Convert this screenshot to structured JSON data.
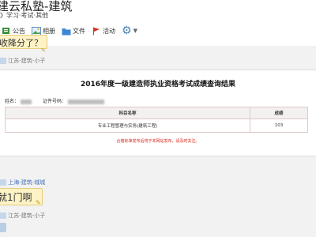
{
  "header": {
    "title": "建云私塾-建筑",
    "subtitle": "》学习·考试·其他"
  },
  "toolbar": {
    "items": [
      {
        "label": "公告"
      },
      {
        "label": "相册"
      },
      {
        "label": "文件"
      },
      {
        "label": "活动"
      }
    ]
  },
  "posts": [
    {
      "text": "收降分了？",
      "meta_location": "江苏-建筑-小子"
    },
    {
      "text": "就1门啊",
      "meta_location_top": "上海-建筑-城城",
      "meta_location": "江苏-建筑-小子"
    }
  ],
  "result": {
    "title": "2016年度一级建造师执业资格考试成绩查询结果",
    "name_label": "姓名：",
    "id_label": "证件号码：",
    "col_subject": "科目名称",
    "col_score": "成绩",
    "rows": [
      {
        "subject": "专业工程管理与实务(建筑工程)",
        "score": "103"
      }
    ],
    "notice": "合格标准发布后将于本网站发布，请及时关注。"
  },
  "icons": {
    "announcement": "announcement-icon",
    "album": "album-icon",
    "file": "folder-icon",
    "activity": "flag-icon",
    "settings": "gear-icon"
  },
  "colors": {
    "link": "#4a74b5",
    "bubble": "#fff3c6",
    "notice": "#d8261c"
  }
}
